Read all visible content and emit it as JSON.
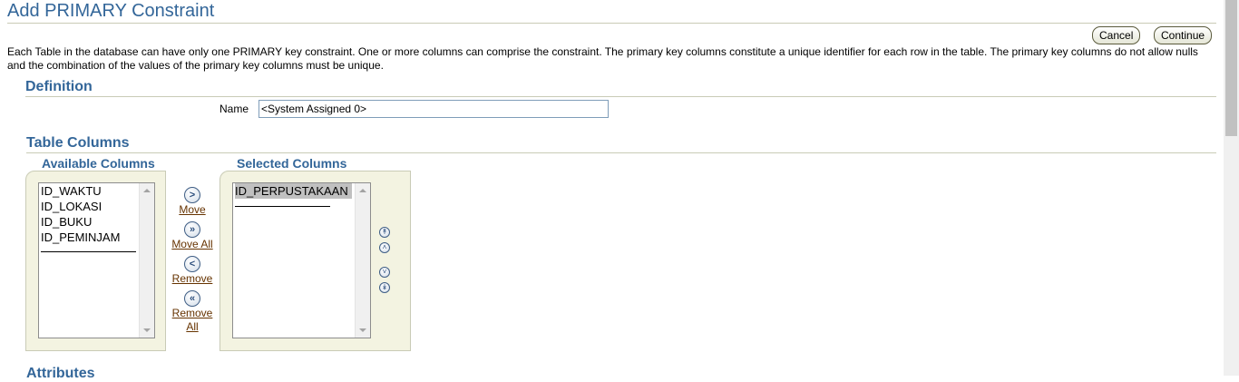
{
  "page": {
    "title": "Add PRIMARY Constraint",
    "description": "Each Table in the database can have only one PRIMARY key constraint. One or more columns can comprise the constraint. The primary key columns constitute a unique identifier for each row in the table. The primary key columns do not allow nulls and the combination of the values of the primary key columns must be unique."
  },
  "toolbar": {
    "cancel_label": "Cancel",
    "continue_label": "Continue"
  },
  "definition": {
    "title": "Definition",
    "name_label": "Name",
    "name_value": "<System Assigned 0>"
  },
  "table_columns": {
    "title": "Table Columns",
    "available_header": "Available Columns",
    "selected_header": "Selected Columns",
    "available": [
      "ID_WAKTU",
      "ID_LOKASI",
      "ID_BUKU",
      "ID_PEMINJAM"
    ],
    "selected": [
      "ID_PERPUSTAKAAN"
    ],
    "move_label": "Move",
    "move_all_label": "Move All",
    "remove_label": "Remove",
    "remove_all_label_1": "Remove",
    "remove_all_label_2": "All"
  },
  "attributes": {
    "title": "Attributes"
  },
  "icons": {
    "move": "move-right-icon",
    "move_all": "move-all-right-icon",
    "remove": "remove-left-icon",
    "remove_all": "remove-all-left-icon",
    "top": "move-top-icon",
    "up": "move-up-icon",
    "down": "move-down-icon",
    "bottom": "move-bottom-icon"
  },
  "colors": {
    "accent": "#336699",
    "panel": "#f3f3e1",
    "link": "#663300"
  }
}
